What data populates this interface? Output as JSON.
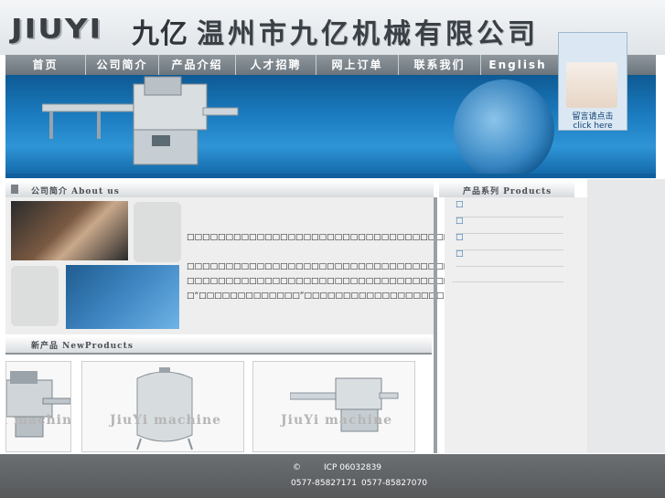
{
  "header": {
    "logo_latin": "JIUYI",
    "logo_cn": "九亿",
    "company_name": "温州市九亿机械有限公司"
  },
  "nav": {
    "items": [
      "首页",
      "公司简介",
      "产品介绍",
      "人才招聘",
      "网上订单",
      "联系我们",
      "English"
    ]
  },
  "contact": {
    "line1": "留言请点击",
    "line2": "click here"
  },
  "about": {
    "title": "公司简介 About us",
    "paragraphs": [
      "　□□□□□□□□□□□□□□□□□□□□□□□□□□□□□□□□□□□□□□□□□□□□□□",
      "　□□□□□□□□□□□□□□□□□□□□□□□□□□□□□□□□□□□□□□□□□□□□□□□□□□",
      "□□□□□□□□□□□□□□□□□□□□□□□□□□□□□□□□□□□□□□□",
      " □“□□□□□□□□□□□□□”□□□□□□□□□□□□□□□□□□□□□□□□□□□□□□"
    ]
  },
  "products": {
    "title": "产品系列 Products",
    "items": [
      "□",
      "□",
      "□",
      "□"
    ]
  },
  "new_products": {
    "title": "新产品 NewProducts",
    "watermarks": [
      "JiuYi machine",
      "JiuYi machine",
      "JiuYi machine"
    ]
  },
  "footer": {
    "copyright": "©",
    "icp": "ICP 06032839",
    "phone1": "0577-85827171",
    "phone2": "0577-85827070"
  },
  "colors": {
    "nav_bg": "#7d858b",
    "banner_blue": "#1b7cc0",
    "footer_bg": "#5f6264",
    "link_blue": "#1f66a8"
  }
}
